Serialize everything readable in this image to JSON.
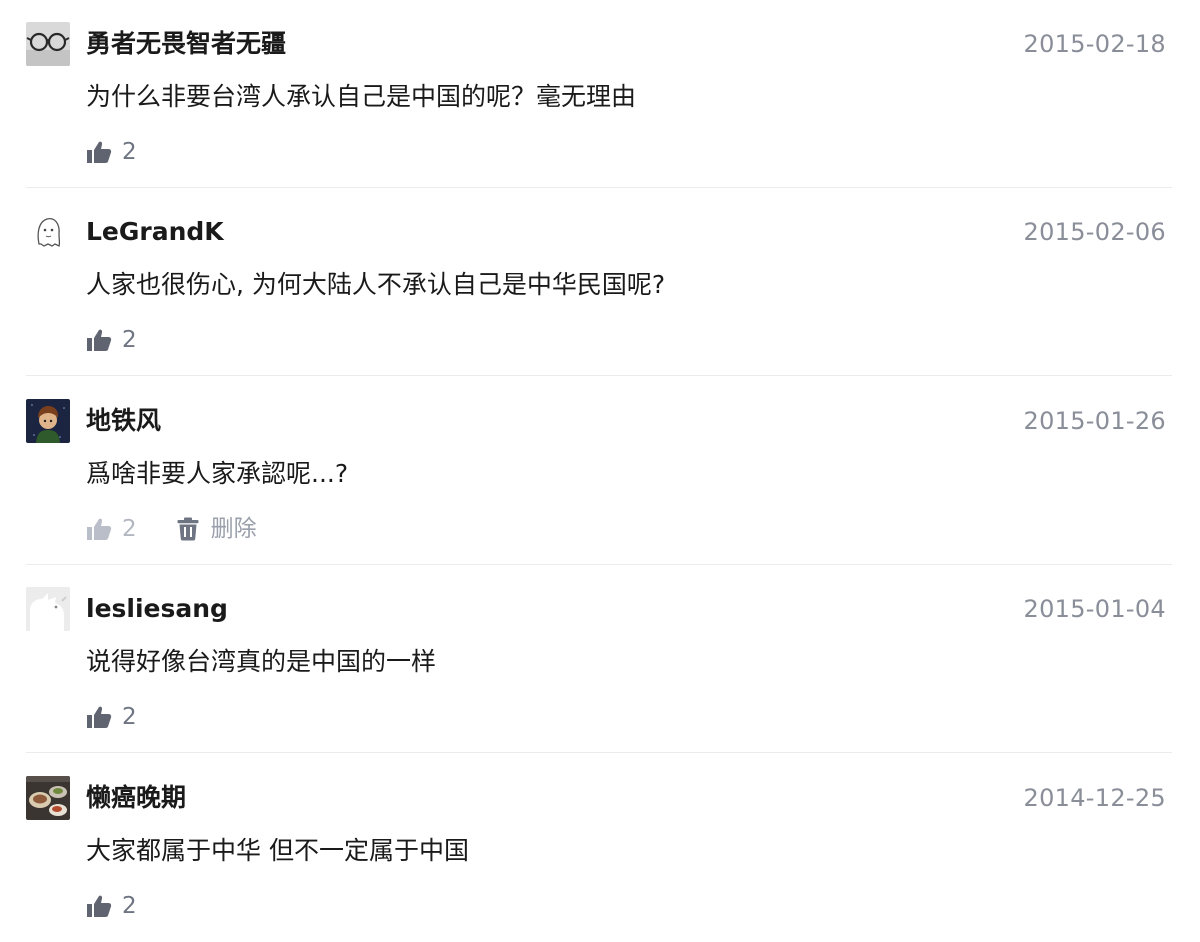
{
  "comments": [
    {
      "username": "勇者无畏智者无疆",
      "date": "2015-02-18",
      "content": "为什么非要台湾人承认自己是中国的呢？毫无理由",
      "likes": "2",
      "avatar": "glasses-avatar"
    },
    {
      "username": "LeGrandK",
      "date": "2015-02-06",
      "content": "人家也很伤心, 为何大陆人不承认自己是中华民国呢?",
      "likes": "2",
      "avatar": "ghost-sketch-avatar"
    },
    {
      "username": "地铁风",
      "date": "2015-01-26",
      "content": "爲啥非要人家承認呢...?",
      "likes": "2",
      "delete_label": "删除",
      "avatar": "boy-night-avatar"
    },
    {
      "username": "lesliesang",
      "date": "2015-01-04",
      "content": "说得好像台湾真的是中国的一样",
      "likes": "2",
      "avatar": "white-cat-avatar"
    },
    {
      "username": "懒癌晚期",
      "date": "2014-12-25",
      "content": "大家都属于中华 但不一定属于中国",
      "likes": "2",
      "avatar": "food-photo-avatar"
    }
  ],
  "colors": {
    "text": "#1a1a1a",
    "date": "#8a8e99",
    "like_icon": "#5f6470",
    "divider": "#ececef"
  }
}
